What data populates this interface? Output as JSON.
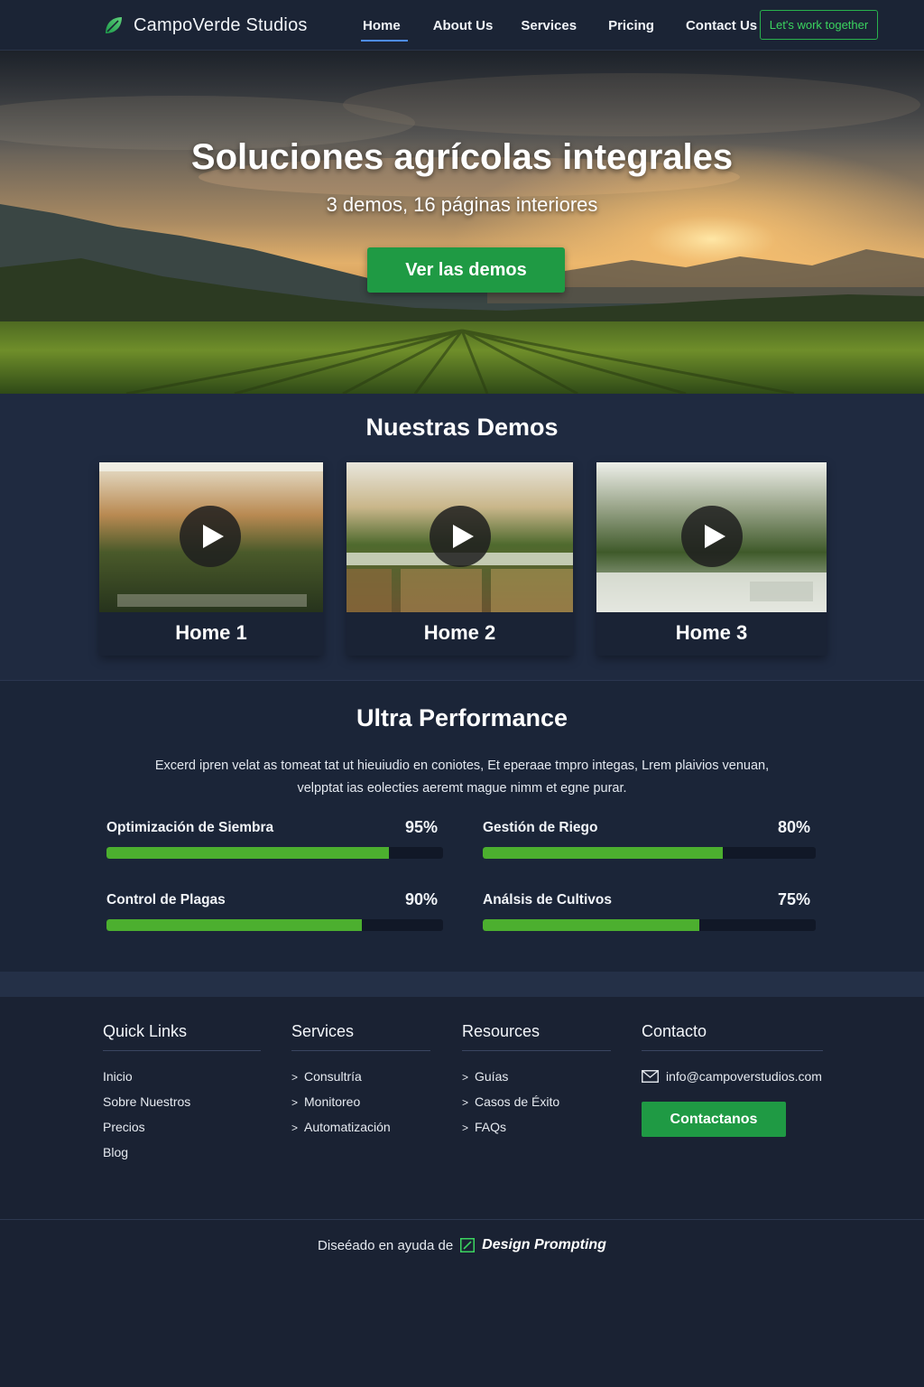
{
  "nav": {
    "brand": "CampoVerde Studios",
    "links": [
      "Home",
      "About Us",
      "Services",
      "Pricing",
      "Contact Us"
    ],
    "active": "Home",
    "cta": "Let's work together"
  },
  "hero": {
    "title": "Soluciones agrícolas integrales",
    "subtitle": "3 demos, 16 páginas interiores",
    "button": "Ver las demos"
  },
  "demos": {
    "title": "Nuestras Demos",
    "items": [
      {
        "label": "Home 1"
      },
      {
        "label": "Home 2"
      },
      {
        "label": "Home 3"
      }
    ]
  },
  "performance": {
    "title": "Ultra Performance",
    "description": "Excerd ipren velat as tomeat tat ut hieuiudio en coniotes, Et eperaae tmpro integas, Lrem plaivios venuan, velpptat ias eolecties aeremt mague nimm et egne purar.",
    "skills": [
      {
        "name": "Optimización de Siembra",
        "value_label": "95%",
        "fill": 0.84
      },
      {
        "name": "Gestión de Riego",
        "value_label": "80%",
        "fill": 0.72
      },
      {
        "name": "Control de Plagas",
        "value_label": "90%",
        "fill": 0.76
      },
      {
        "name": "Análsis de Cultivos",
        "value_label": "75%",
        "fill": 0.65
      }
    ]
  },
  "footer": {
    "quick_links": {
      "title": "Quick Links",
      "items": [
        "Inicio",
        "Sobre Nuestros",
        "Precios",
        "Blog"
      ]
    },
    "services": {
      "title": "Services",
      "items": [
        "Consultría",
        "Monitoreo",
        "Automatización"
      ]
    },
    "resources": {
      "title": "Resources",
      "items": [
        "Guías",
        "Casos de Éxito",
        "FAQs"
      ]
    },
    "contact": {
      "title": "Contacto",
      "email": "info@campoverstudios.com",
      "button": "Contactanos"
    },
    "credit_prefix": "Diseéado en ayuda de",
    "credit_brand": "Design Prompting"
  },
  "colors": {
    "accent_green": "#1f9a44",
    "progress_green": "#4caf2f",
    "nav_underline": "#4d8cf5",
    "background": "#1a2233"
  },
  "icons": {
    "brand": "leaf-icon",
    "play": "play-icon",
    "chevron": "chevron-right-icon",
    "email": "envelope-icon"
  }
}
